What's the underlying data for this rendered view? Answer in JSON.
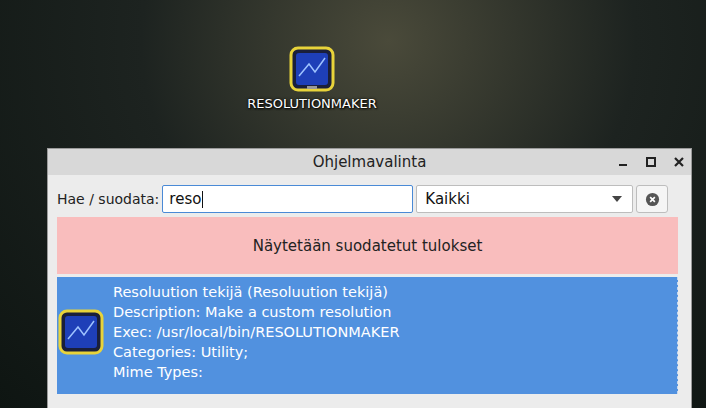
{
  "desktop": {
    "icons": [
      {
        "label": "RESOLUTIONMAKER",
        "selected": false
      }
    ]
  },
  "window": {
    "title": "Ohjelmavalinta"
  },
  "search": {
    "label": "Hae / suodata:",
    "value": "reso"
  },
  "category": {
    "value": "Kaikki"
  },
  "notice": "Näytetään suodatetut tulokset",
  "results": [
    {
      "title": "Resoluution tekijä (Resoluution tekijä)",
      "description": "Description: Make a custom resolution",
      "exec": "Exec: /usr/local/bin/RESOLUTIONMAKER",
      "categories": "Categories: Utility;",
      "mime_types": "Mime Types:",
      "selected": true
    }
  ]
}
